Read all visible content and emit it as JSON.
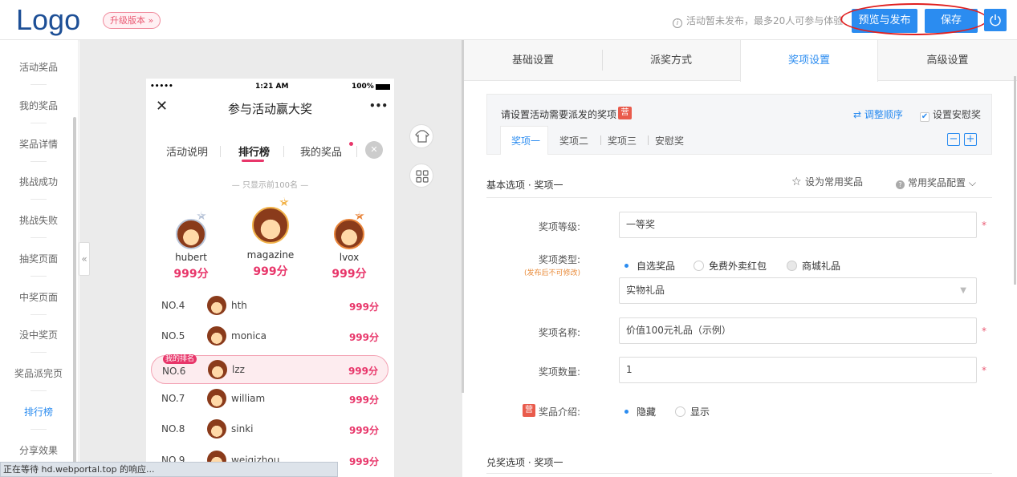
{
  "header": {
    "logo": "Logo",
    "upgrade": "升级版本 »",
    "notice": "活动暂未发布，最多20人可参与体验",
    "notice_icon": "info-icon",
    "preview_publish": "预览与发布",
    "save": "保存",
    "power_icon": "power-icon"
  },
  "sidebar": {
    "items": [
      {
        "label": "活动奖品"
      },
      {
        "label": "我的奖品"
      },
      {
        "label": "奖品详情"
      },
      {
        "label": "挑战成功"
      },
      {
        "label": "挑战失败"
      },
      {
        "label": "抽奖页面"
      },
      {
        "label": "中奖页面"
      },
      {
        "label": "没中奖页"
      },
      {
        "label": "奖品派完页"
      },
      {
        "label": "排行榜"
      },
      {
        "label": "分享效果"
      }
    ],
    "active_color": "#2b8cf0"
  },
  "phone": {
    "status": {
      "signal": "•••••",
      "time": "1:21 AM",
      "battery": "100%"
    },
    "title": "参与活动赢大奖",
    "more": "•••",
    "close": "✕",
    "tabs": [
      "活动说明",
      "排行榜",
      "我的奖品"
    ],
    "note": "— 只显示前100名 —",
    "podium": [
      {
        "rank": "2",
        "name": "hubert",
        "score": "999分"
      },
      {
        "rank": "1",
        "name": "magazine",
        "score": "999分"
      },
      {
        "rank": "3",
        "name": "lvox",
        "score": "999分"
      }
    ],
    "rows": [
      {
        "no": "NO.4",
        "name": "hth",
        "score": "999分"
      },
      {
        "no": "NO.5",
        "name": "monica",
        "score": "999分"
      },
      {
        "no": "NO.6",
        "name": "lzz",
        "score": "999分",
        "mine": "我的排名"
      },
      {
        "no": "NO.7",
        "name": "william",
        "score": "999分"
      },
      {
        "no": "NO.8",
        "name": "sinki",
        "score": "999分"
      },
      {
        "no": "NO.9",
        "name": "weiqizhou",
        "score": "999分"
      }
    ],
    "accent": "#e8366a"
  },
  "tools": {
    "shirt_icon": "shirt-icon",
    "grid_icon": "grid-icon"
  },
  "right": {
    "tabs": [
      "基础设置",
      "派奖方式",
      "奖项设置",
      "高级设置"
    ],
    "box_title": "请设置活动需要派发的奖项",
    "badge": "营",
    "reorder": "调整顺序",
    "consolation_check": "设置安慰奖",
    "prize_tabs": [
      "奖项一",
      "奖项二",
      "奖项三",
      "安慰奖"
    ],
    "section_basic": "基本选项 · 奖项一",
    "set_common": "设为常用奖品",
    "common_config": "常用奖品配置",
    "form": {
      "level_label": "奖项等级:",
      "level_value": "一等奖",
      "type_label": "奖项类型:",
      "type_hint": "(发布后不可修改)",
      "type_options": [
        "自选奖品",
        "免费外卖红包",
        "商城礼品"
      ],
      "type_select": "实物礼品",
      "name_label": "奖项名称:",
      "name_value": "价值100元礼品（示例）",
      "qty_label": "奖项数量:",
      "qty_value": "1",
      "intro_label": "奖品介绍:",
      "intro_options": [
        "隐藏",
        "显示"
      ],
      "required": "*"
    },
    "section_redeem": "兑奖选项 · 奖项一"
  },
  "statusbar": "正在等待 hd.webportal.top 的响应..."
}
